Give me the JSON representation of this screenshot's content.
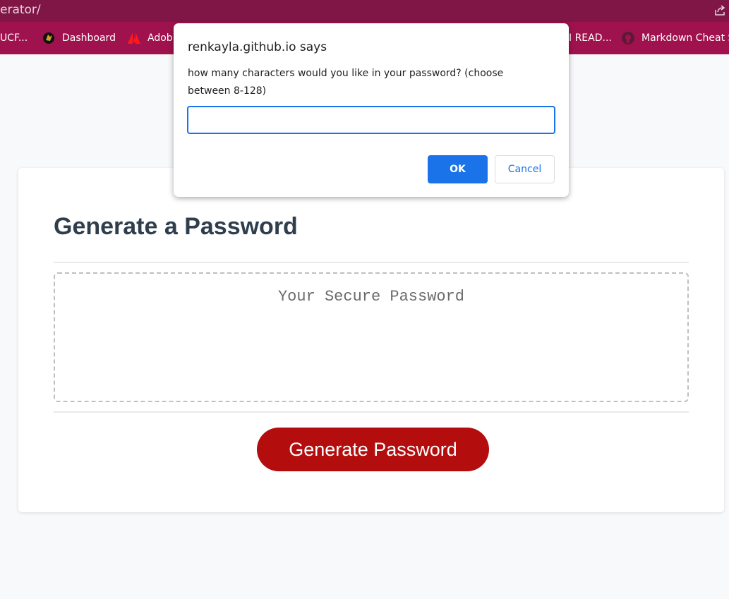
{
  "browser": {
    "url_fragment": "erator/",
    "bookmarks": [
      {
        "label": "UCF...",
        "icon": "bookmark-icon"
      },
      {
        "label": "Dashboard",
        "icon": "knight-logo-icon"
      },
      {
        "label": "Adob",
        "icon": "adobe-icon"
      },
      {
        "label": "I READ...",
        "icon": "bookmark-icon"
      },
      {
        "label": "Markdown Cheat S",
        "icon": "github-icon"
      }
    ]
  },
  "page": {
    "title": "Generate a Password",
    "password_placeholder": "Your Secure Password",
    "generate_label": "Generate Password"
  },
  "dialog": {
    "title": "renkayla.github.io says",
    "message": "how many characters would you like in your password? (choose between 8-128)",
    "input_value": "",
    "ok_label": "OK",
    "cancel_label": "Cancel"
  },
  "colors": {
    "address_bar": "#801646",
    "bookmarks_bar": "#a0124e",
    "generate_button": "#b30d0d",
    "dialog_accent": "#1a73e8"
  }
}
